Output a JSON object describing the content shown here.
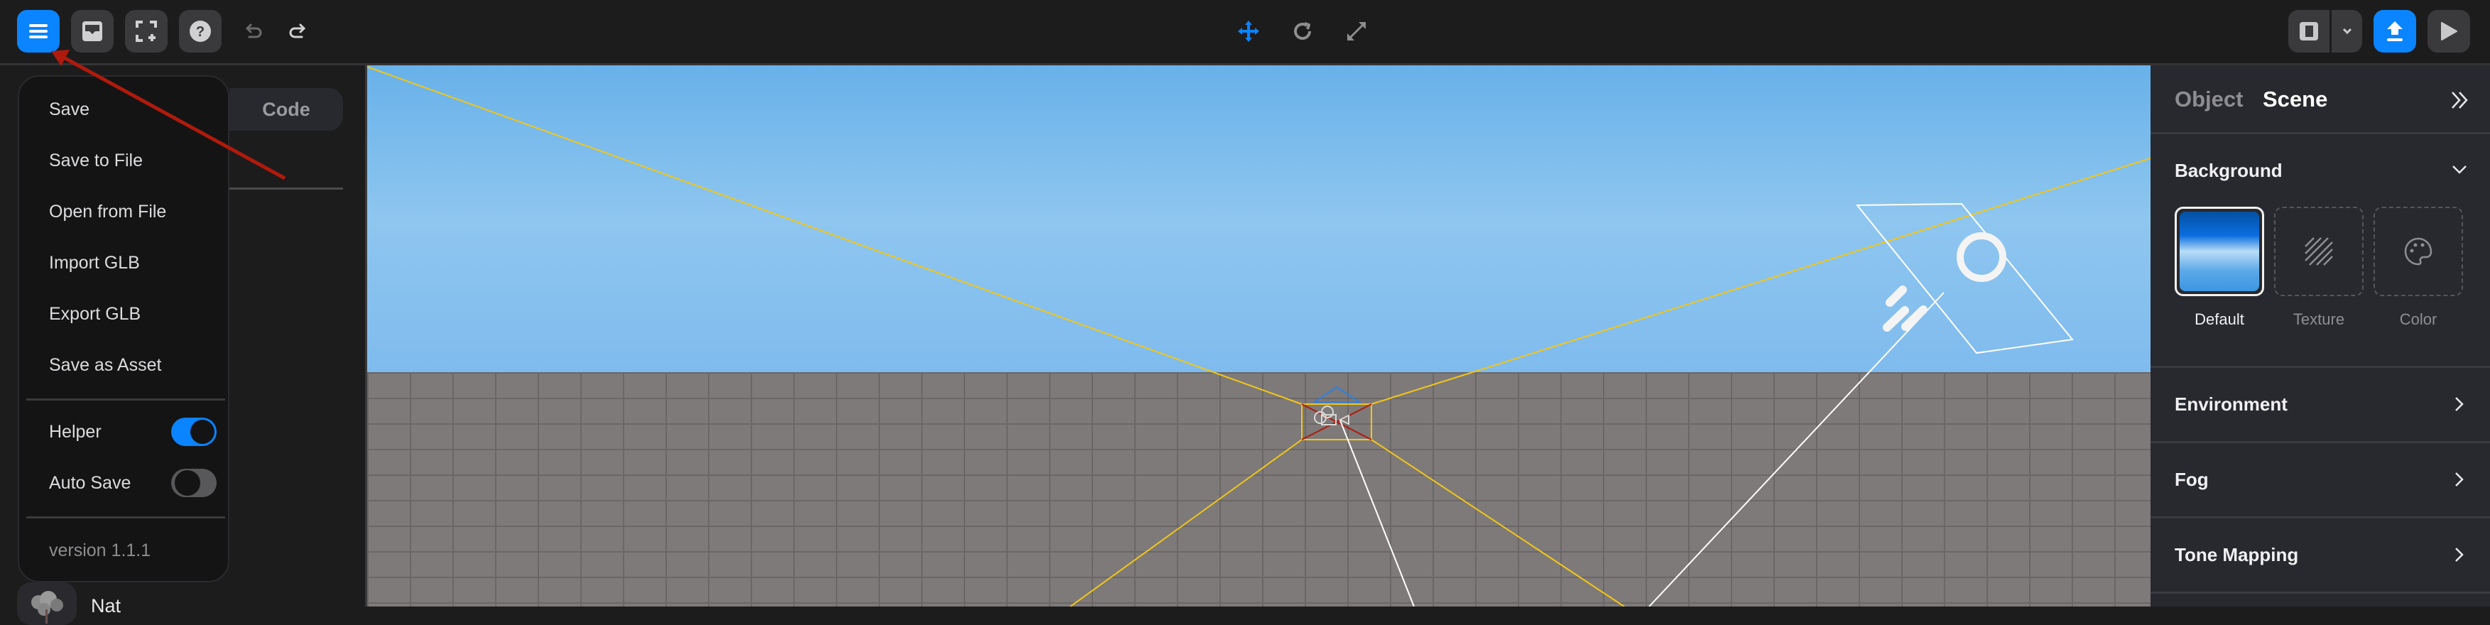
{
  "toolbar": {
    "left_buttons": [
      {
        "name": "menu",
        "icon": "hamburger-icon",
        "active": true
      },
      {
        "name": "assets",
        "icon": "inbox-icon"
      },
      {
        "name": "fullscreen",
        "icon": "focus-frame-icon"
      },
      {
        "name": "help",
        "icon": "question-circle-icon"
      }
    ],
    "undo_icon": "undo-icon",
    "redo_icon": "redo-icon",
    "transform_modes": [
      {
        "name": "move",
        "icon": "move-arrows-icon",
        "active": true
      },
      {
        "name": "rotate",
        "icon": "rotate-icon",
        "active": false
      },
      {
        "name": "scale",
        "icon": "expand-diagonal-icon",
        "active": false
      }
    ],
    "right_buttons": [
      {
        "name": "layout",
        "icon": "panel-layout-icon"
      },
      {
        "name": "layout-dropdown",
        "icon": "chevron-down-icon"
      },
      {
        "name": "publish",
        "icon": "upload-icon",
        "active": true
      },
      {
        "name": "play",
        "icon": "play-icon"
      }
    ]
  },
  "sidebar": {
    "tab_code": "Code",
    "asset_label": "Nat"
  },
  "menu": {
    "items": [
      "Save",
      "Save to File",
      "Open from File",
      "Import GLB",
      "Export GLB",
      "Save as Asset"
    ],
    "toggles": [
      {
        "label": "Helper",
        "on": true
      },
      {
        "label": "Auto Save",
        "on": false
      }
    ],
    "version": "version 1.1.1"
  },
  "right_panel": {
    "tabs": [
      {
        "label": "Object",
        "active": false
      },
      {
        "label": "Scene",
        "active": true
      }
    ],
    "collapse_icon": "double-chevron-right-icon",
    "background": {
      "title": "Background",
      "expanded": true,
      "options": [
        {
          "label": "Default",
          "selected": true,
          "icon": "sky-gradient-preview"
        },
        {
          "label": "Texture",
          "selected": false,
          "icon": "hatch-icon"
        },
        {
          "label": "Color",
          "selected": false,
          "icon": "palette-icon"
        }
      ]
    },
    "sections": [
      {
        "title": "Environment",
        "expanded": false
      },
      {
        "title": "Fog",
        "expanded": false
      },
      {
        "title": "Tone Mapping",
        "expanded": false
      }
    ]
  },
  "colors": {
    "accent": "#0a84ff",
    "annotation_arrow": "#b01a0c",
    "camera_frustum": "#f2c617",
    "sky_top": "#68b1ea",
    "ground": "#7e7a79"
  }
}
